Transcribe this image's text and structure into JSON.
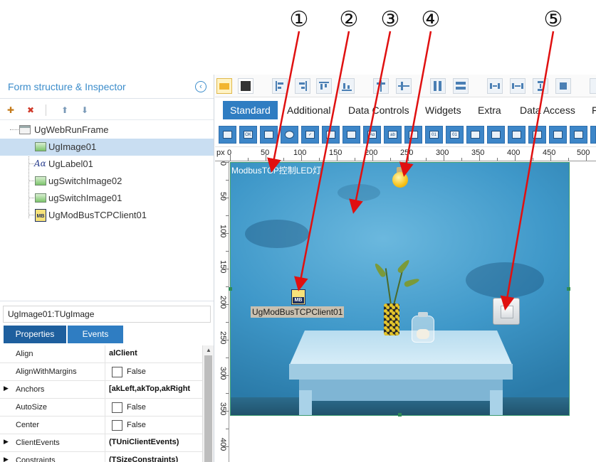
{
  "annotations": {
    "callouts": [
      "①",
      "②",
      "③",
      "④",
      "⑤"
    ],
    "arrow_color": "#e01010"
  },
  "left_panel": {
    "title": "Form structure & Inspector",
    "collapse_icon": "chevron-left-circle-icon",
    "toolbar_icons": [
      "add-component-icon",
      "delete-component-icon",
      "move-up-icon",
      "move-down-icon"
    ],
    "tree": [
      {
        "label": "UgWebRunFrame",
        "icon": "frame-icon",
        "selected": false
      },
      {
        "label": "UgImage01",
        "icon": "image-icon",
        "selected": true
      },
      {
        "label": "UgLabel01",
        "icon": "label-icon",
        "selected": false
      },
      {
        "label": "ugSwitchImage02",
        "icon": "image-icon",
        "selected": false
      },
      {
        "label": "ugSwitchImage01",
        "icon": "image-icon",
        "selected": false
      },
      {
        "label": "UgModBusTCPClient01",
        "icon": "modbus-icon",
        "selected": false
      }
    ]
  },
  "inspector": {
    "component": "UgImage01:TUgImage",
    "tabs": [
      "Properties",
      "Events"
    ],
    "active_tab": "Properties",
    "properties": [
      {
        "name": "Align",
        "value": "alClient",
        "type": "text",
        "expandable": false
      },
      {
        "name": "AlignWithMargins",
        "value": "False",
        "type": "checkbox",
        "expandable": false
      },
      {
        "name": "Anchors",
        "value": "[akLeft,akTop,akRight",
        "type": "text",
        "expandable": true
      },
      {
        "name": "AutoSize",
        "value": "False",
        "type": "checkbox",
        "expandable": false
      },
      {
        "name": "Center",
        "value": "False",
        "type": "checkbox",
        "expandable": false
      },
      {
        "name": "ClientEvents",
        "value": "(TUniClientEvents)",
        "type": "text",
        "expandable": true
      },
      {
        "name": "Constraints",
        "value": "(TSizeConstraints)",
        "type": "text",
        "expandable": true
      }
    ]
  },
  "designer": {
    "tabs": [
      "Standard",
      "Additional",
      "Data Controls",
      "Widgets",
      "Extra",
      "Data Access",
      "F"
    ],
    "active_tab": "Standard",
    "ruler_unit": "px",
    "h_ruler": [
      "0",
      "50",
      "100",
      "150",
      "200",
      "250",
      "300",
      "350",
      "400",
      "450",
      "500"
    ],
    "v_ruler": [
      "0",
      "50",
      "100",
      "150",
      "200",
      "250",
      "300",
      "350",
      "400"
    ],
    "canvas": {
      "label_text": "ModbusTCP控制LED灯",
      "modbus_component_label": "UgModBusTCPClient01",
      "modbus_icon_text": "MB",
      "bulb_icon": "light-bulb-icon",
      "switch_icon": "wall-switch-icon"
    }
  }
}
